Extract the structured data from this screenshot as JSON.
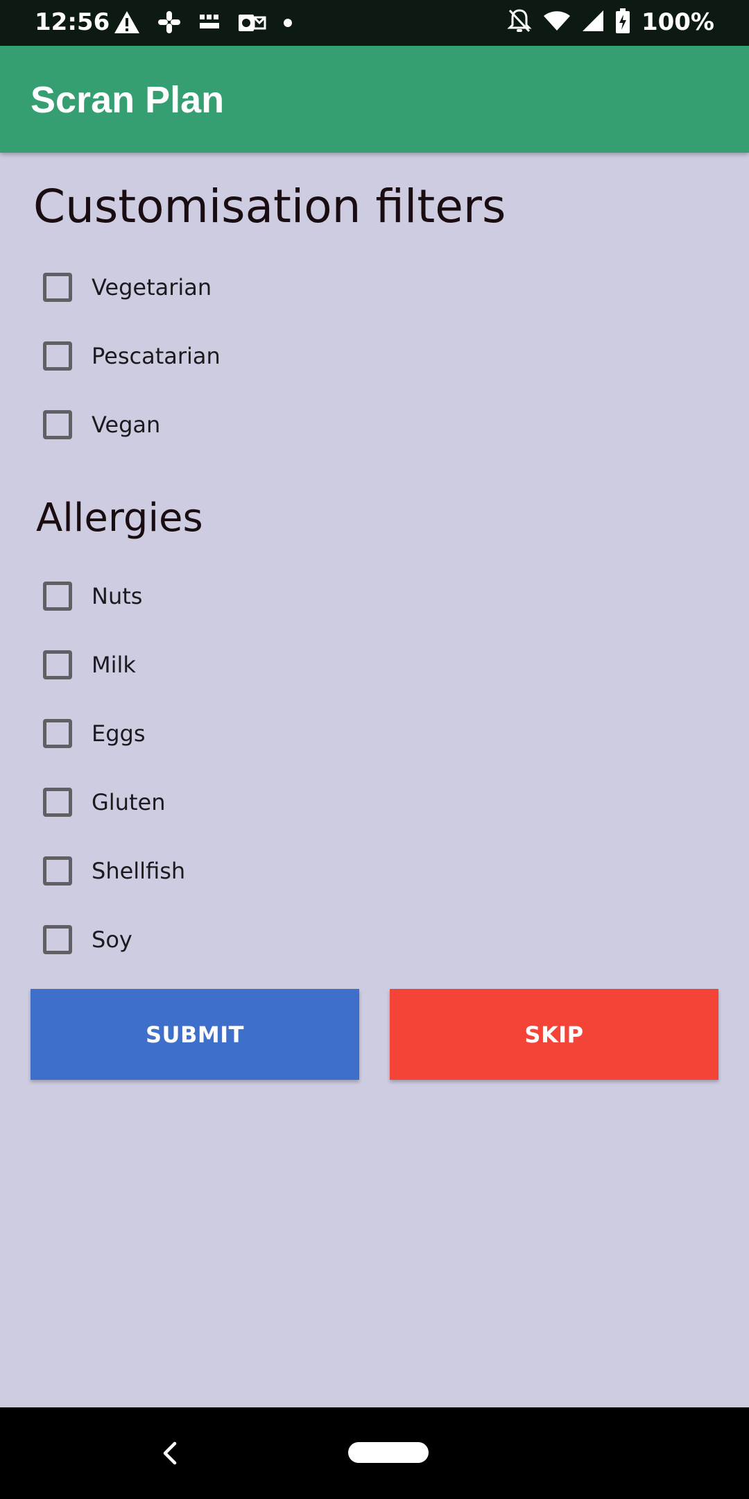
{
  "status_bar": {
    "time": "12:56",
    "battery_text": "100%",
    "left_icons": [
      "warning-icon",
      "slack-icon",
      "bbc-news-icon",
      "outlook-icon",
      "dot-icon"
    ],
    "right_icons": [
      "notifications-off-icon",
      "wifi-icon",
      "cell-signal-icon",
      "battery-charging-icon"
    ]
  },
  "app_bar": {
    "title": "Scran Plan",
    "color": "#369f72"
  },
  "customisation": {
    "title": "Customisation filters",
    "options": [
      {
        "label": "Vegetarian",
        "checked": false
      },
      {
        "label": "Pescatarian",
        "checked": false
      },
      {
        "label": "Vegan",
        "checked": false
      }
    ]
  },
  "allergies": {
    "title": "Allergies",
    "options": [
      {
        "label": "Nuts",
        "checked": false
      },
      {
        "label": "Milk",
        "checked": false
      },
      {
        "label": "Eggs",
        "checked": false
      },
      {
        "label": "Gluten",
        "checked": false
      },
      {
        "label": "Shellfish",
        "checked": false
      },
      {
        "label": "Soy",
        "checked": false
      }
    ]
  },
  "actions": {
    "submit_label": "SUBMIT",
    "submit_color": "#3e6fca",
    "skip_label": "SKIP",
    "skip_color": "#f44337"
  },
  "nav_bar": {
    "back_icon": "back-chevron-icon",
    "home_icon": "home-pill-icon"
  }
}
